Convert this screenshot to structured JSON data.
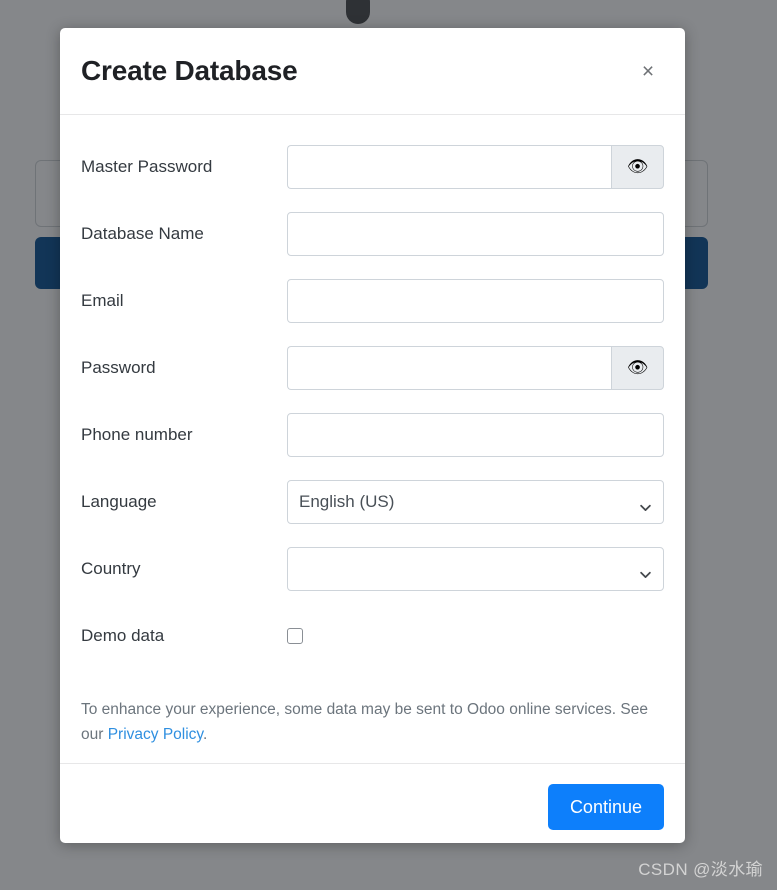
{
  "background": {
    "card_present": true,
    "primary_button_color": "#014a8f",
    "overlay_color": "rgba(33,37,41,0.55)"
  },
  "watermark": {
    "text": "CSDN @淡水瑜"
  },
  "modal": {
    "title": "Create Database",
    "close_label": "×",
    "fields": [
      {
        "id": "master-password",
        "label": "Master Password",
        "type": "password",
        "value": "",
        "placeholder": "",
        "toggle_icon": "eye-icon",
        "toggle_glyph": "👁"
      },
      {
        "id": "database-name",
        "label": "Database Name",
        "type": "text",
        "value": "",
        "placeholder": ""
      },
      {
        "id": "email",
        "label": "Email",
        "type": "text",
        "value": "",
        "placeholder": ""
      },
      {
        "id": "password",
        "label": "Password",
        "type": "password",
        "value": "",
        "placeholder": "",
        "toggle_icon": "eye-icon",
        "toggle_glyph": "👁"
      },
      {
        "id": "phone-number",
        "label": "Phone number",
        "type": "text",
        "value": "",
        "placeholder": ""
      },
      {
        "id": "language",
        "label": "Language",
        "type": "select",
        "value": "English (US)",
        "options": [
          "English (US)"
        ]
      },
      {
        "id": "country",
        "label": "Country",
        "type": "select",
        "value": "",
        "options": [
          ""
        ]
      },
      {
        "id": "demo-data",
        "label": "Demo data",
        "type": "checkbox",
        "checked": false
      }
    ],
    "privacy_note": {
      "text_before": "To enhance your experience, some data may be sent to Odoo online services. See our ",
      "link_text": "Privacy Policy",
      "text_after": ".",
      "link_color": "#2f8fe0"
    },
    "footer": {
      "continue_label": "Continue",
      "continue_color": "#0d7ffb"
    }
  }
}
